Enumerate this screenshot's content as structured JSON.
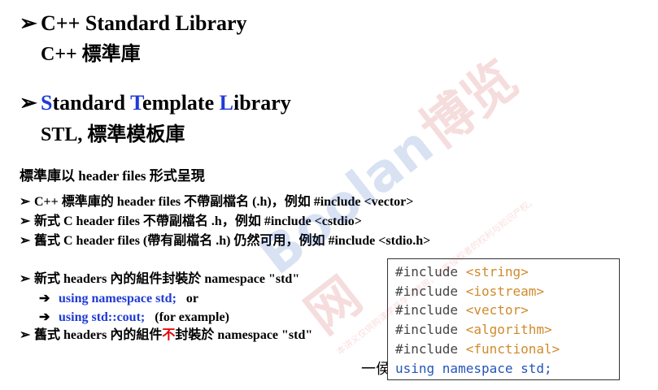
{
  "heading1": {
    "arrow": "➢",
    "title": "C++ Standard Library",
    "subtitle": "C++ 標準庫"
  },
  "heading2": {
    "arrow": "➢",
    "s_letter": "S",
    "s_rest": "tandard ",
    "t_letter": "T",
    "t_rest": "emplate ",
    "l_letter": "L",
    "l_rest": "ibrary",
    "subtitle": "STL, 標準模板庫"
  },
  "intro": "標準庫以 header files 形式呈現",
  "bullets": [
    "C++ 標準庫的 header files 不帶副檔名 (.h)，例如  #include <vector>",
    "新式 C header files 不帶副檔名 .h，例如 #include <cstdio>",
    "舊式 C header files (帶有副檔名 .h) 仍然可用，例如 #include <stdio.h>"
  ],
  "bullet_marker": "➢",
  "ns_section": {
    "new_headers": "新式 headers 內的組件封裝於 namespace \"std\"",
    "arrow": "➔",
    "using_ns": "using namespace std;",
    "or": "or",
    "using_cout": "using std::cout;",
    "example": "(for example)",
    "old_prefix": "舊式 headers 內的組件",
    "old_red": "不",
    "old_suffix": "封裝於 namespace \"std\"",
    "footer_fragment": "一侯"
  },
  "code_box": {
    "include_kw": "#include ",
    "headers": [
      "<string>",
      "<iostream>",
      "<vector>",
      "<algorithm>",
      "<functional>"
    ],
    "using_line": "using namespace std;"
  },
  "watermark": {
    "text_cn": "博览网",
    "text_en": "Boolan",
    "fine_print": "本讲义仅供购课学员学习使用，伤害侵权者的权利与知识产权。"
  },
  "colors": {
    "accent_blue": "#1f3bd6",
    "accent_red": "#e00000",
    "code_header": "#d08a2c",
    "code_using": "#2455b8"
  }
}
